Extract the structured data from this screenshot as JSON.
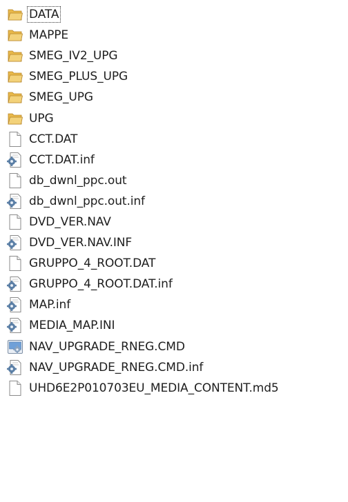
{
  "files": [
    {
      "name": "DATA",
      "type": "folder",
      "icon": "folder-icon"
    },
    {
      "name": "MAPPE",
      "type": "folder",
      "icon": "folder-icon"
    },
    {
      "name": "SMEG_IV2_UPG",
      "type": "folder",
      "icon": "folder-icon"
    },
    {
      "name": "SMEG_PLUS_UPG",
      "type": "folder",
      "icon": "folder-icon"
    },
    {
      "name": "SMEG_UPG",
      "type": "folder",
      "icon": "folder-icon"
    },
    {
      "name": "UPG",
      "type": "folder",
      "icon": "folder-icon"
    },
    {
      "name": "CCT.DAT",
      "type": "file",
      "icon": "file-icon"
    },
    {
      "name": "CCT.DAT.inf",
      "type": "settings",
      "icon": "settings-file-icon"
    },
    {
      "name": "db_dwnl_ppc.out",
      "type": "file",
      "icon": "file-icon"
    },
    {
      "name": "db_dwnl_ppc.out.inf",
      "type": "settings",
      "icon": "settings-file-icon"
    },
    {
      "name": "DVD_VER.NAV",
      "type": "file",
      "icon": "file-icon"
    },
    {
      "name": "DVD_VER.NAV.INF",
      "type": "settings",
      "icon": "settings-file-icon"
    },
    {
      "name": "GRUPPO_4_ROOT.DAT",
      "type": "file",
      "icon": "file-icon"
    },
    {
      "name": "GRUPPO_4_ROOT.DAT.inf",
      "type": "settings",
      "icon": "settings-file-icon"
    },
    {
      "name": "MAP.inf",
      "type": "settings",
      "icon": "settings-file-icon"
    },
    {
      "name": "MEDIA_MAP.INI",
      "type": "settings",
      "icon": "settings-file-icon"
    },
    {
      "name": "NAV_UPGRADE_RNEG.CMD",
      "type": "command",
      "icon": "command-script-icon"
    },
    {
      "name": "NAV_UPGRADE_RNEG.CMD.inf",
      "type": "settings",
      "icon": "settings-file-icon"
    },
    {
      "name": "UHD6E2P010703EU_MEDIA_CONTENT.md5",
      "type": "file",
      "icon": "file-icon"
    }
  ],
  "focused_index": 0,
  "colors": {
    "folder_body": "#e8b84a",
    "folder_front": "#f3d27a",
    "folder_edge": "#b8862a",
    "file_border": "#8a8a8a",
    "gear": "#5b7fa6",
    "cmd_screen": "#6fa0d8"
  }
}
